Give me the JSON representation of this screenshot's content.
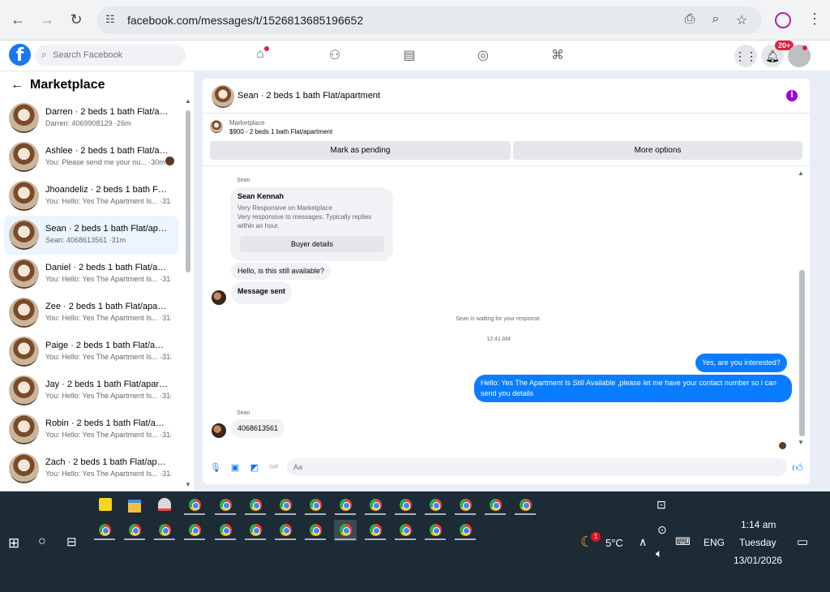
{
  "browser": {
    "url": "facebook.com/messages/t/1526813685196652"
  },
  "fb": {
    "search_placeholder": "Search Facebook",
    "notification_badge": "20+"
  },
  "sidebar": {
    "title": "Marketplace",
    "conversations": [
      {
        "name": "Darren · 2 beds 1 bath Flat/apartment",
        "preview": "Darren: 4069908129 ·26m",
        "active": false
      },
      {
        "name": "Ashlee · 2 beds 1 bath Flat/apartment",
        "preview": "You: Please send me your nu... ·30m",
        "active": false
      },
      {
        "name": "Jhoandeliz · 2 beds 1 bath Flat/apartment",
        "preview": "You: Hello: Yes The Apartment Is... ·31m",
        "active": false
      },
      {
        "name": "Sean · 2 beds 1 bath Flat/apartment",
        "preview": "Sean: 4068613561 ·31m",
        "active": true
      },
      {
        "name": "Daniel · 2 beds 1 bath Flat/apartment",
        "preview": "You: Hello: Yes The Apartment Is... ·31m",
        "active": false
      },
      {
        "name": "Zee · 2 beds 1 bath Flat/apartment",
        "preview": "You: Hello: Yes The Apartment Is... ·31m",
        "active": false
      },
      {
        "name": "Paige · 2 beds 1 bath Flat/apartment",
        "preview": "You: Hello: Yes The Apartment Is... ·31m",
        "active": false
      },
      {
        "name": "Jay · 2 beds 1 bath Flat/apartment",
        "preview": "You: Hello: Yes The Apartment Is... ·31m",
        "active": false
      },
      {
        "name": "Robin · 2 beds 1 bath Flat/apartment",
        "preview": "You: Hello: Yes The Apartment Is... ·31m",
        "active": false
      },
      {
        "name": "Zach · 2 beds 1 bath Flat/apartment",
        "preview": "You: Hello: Yes The Apartment Is... ·31m",
        "active": false
      }
    ]
  },
  "chat": {
    "title": "Sean · 2 beds 1 bath Flat/apartment",
    "listing_label": "Marketplace",
    "listing_price": "$900 - 2 beds 1 bath Flat/apartment",
    "mark_pending": "Mark as pending",
    "more_options": "More options",
    "sender_name": "Sean",
    "card_name": "Sean Kennah",
    "card_line1": "Very Responsive on Marketplace",
    "card_line2": "Very responsive to messages. Typically replies within an hour.",
    "buyer_details": "Buyer details",
    "msg_available": "Hello, is this still available?",
    "msg_sent": "Message sent",
    "waiting": "Sean is waiting for your response.",
    "time": "12:41 AM",
    "out1": "Yes, are you interested?",
    "out2": "Hello: Yes The Apartment Is Still Available ,please let me have your contact number so i can send you details",
    "msg_number": "4068613561",
    "composer_placeholder": "Aa"
  },
  "taskbar": {
    "weather_temp": "5°C",
    "weather_badge": "1",
    "lang": "ENG",
    "time": "1:14 am",
    "day": "Tuesday",
    "date": "13/01/2026"
  }
}
